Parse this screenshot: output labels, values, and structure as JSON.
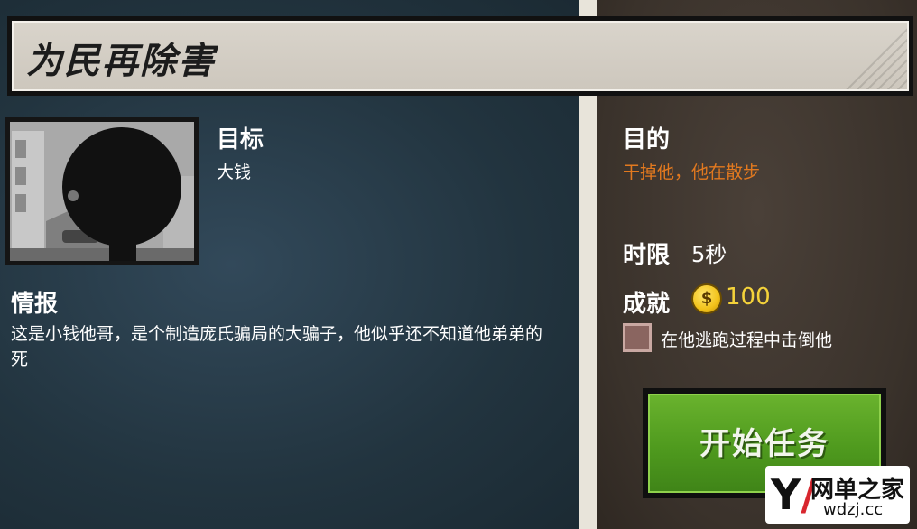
{
  "mission": {
    "title": "为民再除害",
    "target_label": "目标",
    "target_name": "大钱",
    "intel_label": "情报",
    "intel_text": "这是小钱他哥，是个制造庞氏骗局的大骗子，他似乎还不知道他弟弟的死"
  },
  "objectives": {
    "purpose_label": "目的",
    "purpose_text": "干掉他，他在散步",
    "time_limit_label": "时限",
    "time_limit_value": "5秒",
    "achievement_label": "成就",
    "coin_symbol": "$",
    "reward_value": "100",
    "bonus_task": "在他逃跑过程中击倒他",
    "bonus_checked": false
  },
  "start_button": {
    "label": "开始任务"
  },
  "watermark": {
    "brand": "网单之家",
    "url": "wdzj.cc"
  },
  "colors": {
    "accent_orange": "#e2791f",
    "reward_yellow": "#f4d23a",
    "start_green": "#4f9a1e"
  }
}
